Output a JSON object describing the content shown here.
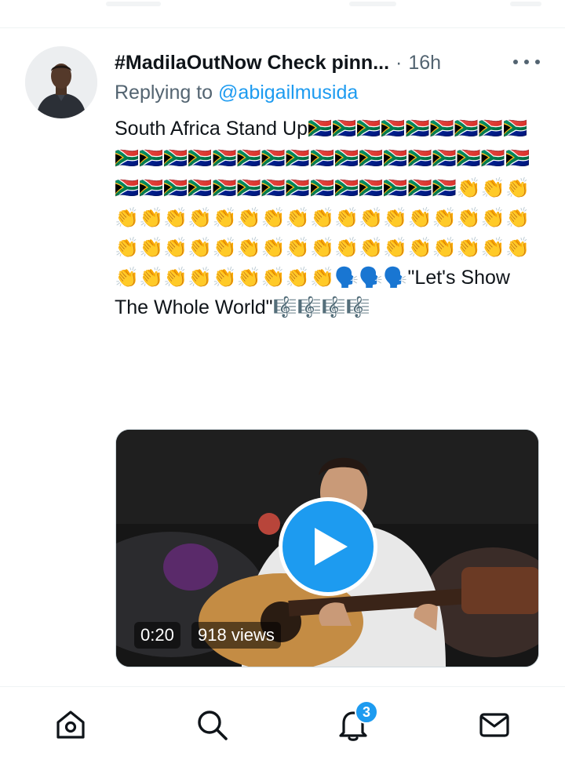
{
  "tweet": {
    "author_name": "#MadilaOutNow Check pinn...",
    "separator": "·",
    "time": "16h",
    "more_icon": "more-icon",
    "replying_prefix": "Replying to",
    "replying_handle": "@abigailmusida",
    "text_start": "South Africa Stand Up",
    "flag_emoji": "🇿🇦",
    "flag_count": 40,
    "clap_emoji": "👏",
    "clap_count": 46,
    "speak_emoji": "🗣️",
    "speak_count": 3,
    "quote_text": "\"Let's Show The Whole World\"",
    "music_emoji": "🎼",
    "music_count": 4
  },
  "media": {
    "type": "video",
    "play_icon": "play-icon",
    "duration": "0:20",
    "views": "918 views"
  },
  "tabbar": {
    "items": [
      {
        "name": "home",
        "icon": "home-icon"
      },
      {
        "name": "search",
        "icon": "search-icon"
      },
      {
        "name": "notifications",
        "icon": "bell-icon",
        "badge": "3"
      },
      {
        "name": "messages",
        "icon": "mail-icon"
      }
    ]
  },
  "colors": {
    "accent": "#1d9bf0",
    "secondary_text": "#536471",
    "primary_text": "#0f1419",
    "divider": "#eff3f4"
  }
}
